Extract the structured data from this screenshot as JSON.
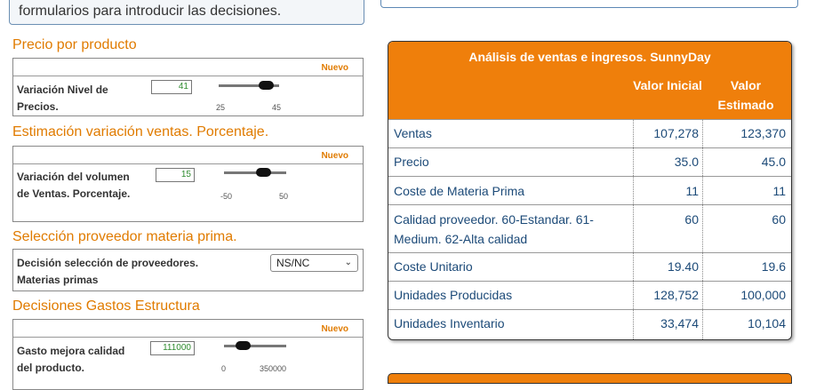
{
  "intro": {
    "text": "formularios para introducir las decisiones."
  },
  "sections": {
    "precio": {
      "title": "Precio por producto",
      "nuevo": "Nuevo",
      "label": "Variación Nivel de Precios.",
      "value": "41",
      "min": "25",
      "max": "45"
    },
    "ventas": {
      "title": "Estimación variación ventas. Porcentaje.",
      "nuevo": "Nuevo",
      "label": "Variación del volumen de Ventas. Porcentaje.",
      "value": "15",
      "min": "-50",
      "max": "50"
    },
    "proveedor": {
      "title": "Selección proveedor materia prima.",
      "label": "Decisión selección de proveedores. Materias primas",
      "selected": "NS/NC"
    },
    "gastos": {
      "title": "Decisiones Gastos Estructura",
      "nuevo": "Nuevo",
      "label": "Gasto mejora calidad del producto.",
      "value": "111000",
      "min": "0",
      "max": "350000"
    }
  },
  "sales_table": {
    "title": "Análisis de ventas e ingresos. SunnyDay",
    "col1": "Valor Inicial",
    "col2": "Valor Estimado",
    "rows": [
      {
        "label": "Ventas",
        "inicial": "107,278",
        "estimado": "123,370"
      },
      {
        "label": "Precio",
        "inicial": "35.0",
        "estimado": "45.0"
      },
      {
        "label": "Coste de Materia Prima",
        "inicial": "11",
        "estimado": "11"
      },
      {
        "label": "Calidad proveedor. 60-Estandar. 61-Medium. 62-Alta calidad",
        "inicial": "60",
        "estimado": "60"
      },
      {
        "label": "Coste Unitario",
        "inicial": "19.40",
        "estimado": "19.6"
      },
      {
        "label": "Unidades Producidas",
        "inicial": "128,752",
        "estimado": "100,000"
      },
      {
        "label": "Unidades Inventario",
        "inicial": "33,474",
        "estimado": "10,104"
      }
    ]
  },
  "colors": {
    "accent": "#ef7f0b",
    "title_orange": "#e07b00",
    "table_text": "#1c4a78",
    "input_green": "#2e8b2e"
  }
}
